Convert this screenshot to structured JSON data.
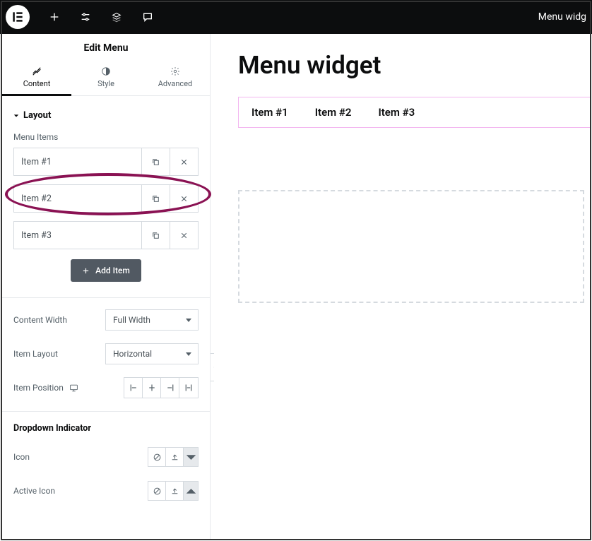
{
  "topbar": {
    "right_text": "Menu widg"
  },
  "panel": {
    "title": "Edit Menu",
    "tabs": {
      "content": "Content",
      "style": "Style",
      "advanced": "Advanced"
    },
    "section_layout": "Layout",
    "menu_items_label": "Menu Items",
    "items": [
      {
        "label": "Item #1"
      },
      {
        "label": "Item #2"
      },
      {
        "label": "Item #3"
      }
    ],
    "add_item": "Add Item",
    "content_width_label": "Content Width",
    "content_width_value": "Full Width",
    "item_layout_label": "Item Layout",
    "item_layout_value": "Horizontal",
    "item_position_label": "Item Position",
    "dropdown_indicator": "Dropdown Indicator",
    "icon_label": "Icon",
    "active_icon_label": "Active Icon"
  },
  "canvas": {
    "page_title": "Menu widget",
    "menu_items": [
      "Item #1",
      "Item #2",
      "Item #3"
    ]
  }
}
